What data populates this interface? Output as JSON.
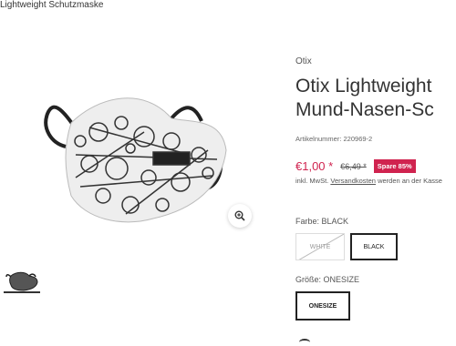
{
  "breadcrumb": "Lightweight Schutzmaske",
  "gallery": {
    "zoom_icon": "zoom-in-icon"
  },
  "product": {
    "brand": "Otix",
    "title_line1": "Otix Lightweight",
    "title_line2": "Mund-Nasen-Sc",
    "article_number": "Artikelnummer: 220969-2",
    "price": "€1,00 *",
    "old_price": "€6,49 *",
    "sale_badge": "Spare 85%",
    "tax_prefix": "inkl. MwSt.",
    "tax_link": "Versandkosten",
    "tax_suffix": "werden an der Kasse",
    "price_color": "#d0234f"
  },
  "variants": {
    "color_label": "Farbe:  BLACK",
    "color_options": [
      "WHITE",
      "BLACK"
    ],
    "size_label": "Größe:  ONESIZE",
    "size_options": [
      "ONESIZE"
    ]
  }
}
